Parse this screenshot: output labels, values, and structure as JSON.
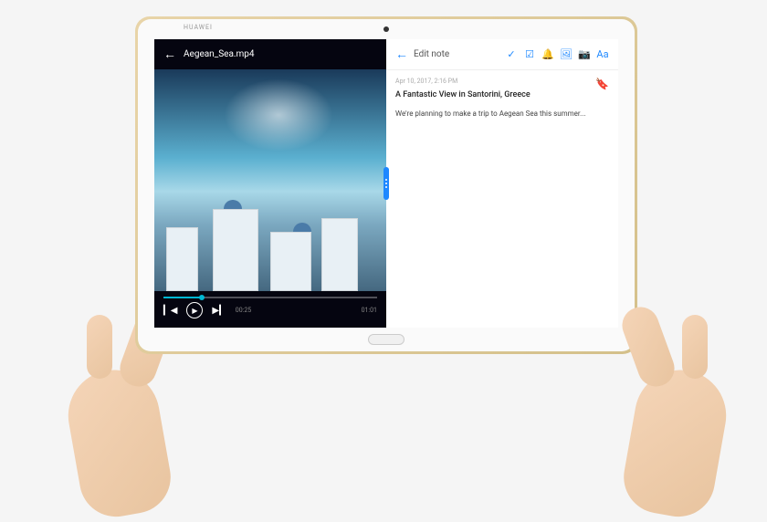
{
  "tablet": {
    "brand": "HUAWEI"
  },
  "video": {
    "title": "Aegean_Sea.mp4",
    "current_time": "00:25",
    "total_time": "01:01"
  },
  "note": {
    "header_title": "Edit note",
    "aa_label": "Aa",
    "timestamp": "Apr 10, 2017, 2:16 PM",
    "heading": "A Fantastic View in Santorini, Greece",
    "body": "We're planning to make a trip to Aegean Sea this summer..."
  }
}
